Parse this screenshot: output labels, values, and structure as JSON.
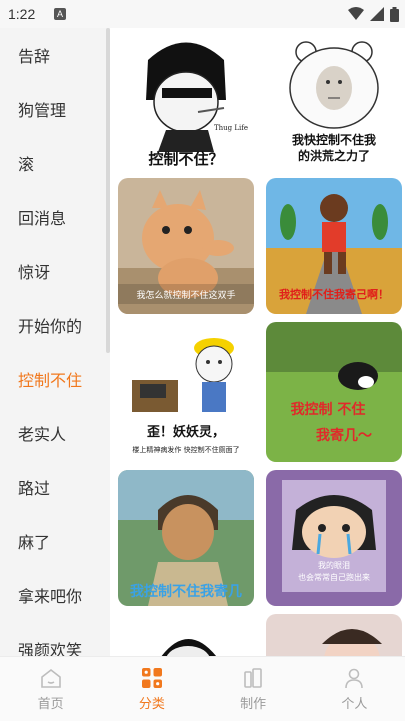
{
  "status": {
    "time": "1:22",
    "notif": "A"
  },
  "sidebar": {
    "items": [
      {
        "label": "告辞"
      },
      {
        "label": "狗管理"
      },
      {
        "label": "滚"
      },
      {
        "label": "回消息"
      },
      {
        "label": "惊讶"
      },
      {
        "label": "开始你的"
      },
      {
        "label": "控制不住"
      },
      {
        "label": "老实人"
      },
      {
        "label": "路过"
      },
      {
        "label": "麻了"
      },
      {
        "label": "拿来吧你"
      },
      {
        "label": "强颜欢笑"
      }
    ],
    "active_index": 6
  },
  "memes": {
    "m1_caption": "控制不住？",
    "m1_tag": "Thug Life",
    "m2_line1": "我快控制不住我",
    "m2_line2": "的洪荒之力了",
    "m3_caption": "我怎么就控制不住这双手",
    "m4_caption": "我控制不住我寄己啊！",
    "m5_title": "歪！妖妖灵，",
    "m5_sub": "楼上精神病发作  快控制不住厕面了",
    "m6_line1": "我控制  不住",
    "m6_line2": "我寄几～",
    "m7_caption": "我控制不住我寄几",
    "m8_line1": "我的眼泪",
    "m8_line2": "也会常常自己跑出来"
  },
  "tabs": [
    {
      "label": "首页",
      "icon": "home-icon"
    },
    {
      "label": "分类",
      "icon": "category-icon"
    },
    {
      "label": "制作",
      "icon": "make-icon"
    },
    {
      "label": "个人",
      "icon": "person-icon"
    }
  ],
  "colors": {
    "accent": "#f1781d",
    "inactive": "#9a9a9a"
  }
}
